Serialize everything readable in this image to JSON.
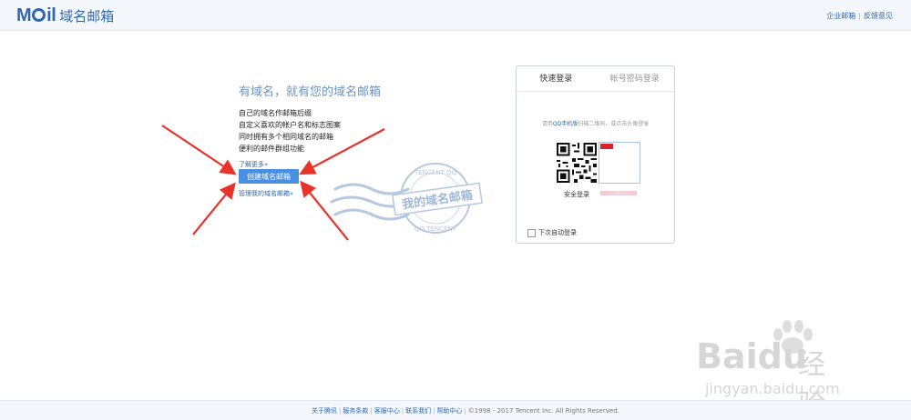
{
  "header": {
    "logo_text": "域名邮箱",
    "links": [
      "企业邮箱",
      "反馈意见"
    ]
  },
  "intro": {
    "title": "有域名，就有您的域名邮箱",
    "lines": [
      "自己的域名作邮箱后缀",
      "自定义喜欢的帐户名和标志图案",
      "同时拥有多个相同域名的邮箱",
      "便利的邮件群组功能"
    ],
    "learn_more": "了解更多»",
    "create_button": "创建域名邮箱",
    "manage_link": "管理我的域名邮箱»"
  },
  "stamp": {
    "center_text": "我的域名邮箱",
    "top_arc": "TENCENT QQ",
    "bottom_arc": "QQ TENCENT"
  },
  "login": {
    "tabs": [
      "快速登录",
      "帐号密码登录"
    ],
    "hint_prefix": "请用",
    "hint_highlight": "QQ手机版",
    "hint_suffix": "扫描二维码，或点击头像登录",
    "vip_tag": "vip",
    "secure_label": "安全登录",
    "auto_login": "下次自动登录"
  },
  "watermark": {
    "brand": "Bai",
    "brand2": "du",
    "cn": "经验",
    "url": "jingyan.baidu.com"
  },
  "footer": {
    "links": [
      "关于腾讯",
      "服务条款",
      "客服中心",
      "联系我们",
      "帮助中心"
    ],
    "copyright": "©1998 - 2017 Tencent Inc. All Rights Reserved."
  },
  "colors": {
    "accent": "#2e68b5",
    "button": "#4a90e2",
    "arrow": "#e8332a"
  }
}
